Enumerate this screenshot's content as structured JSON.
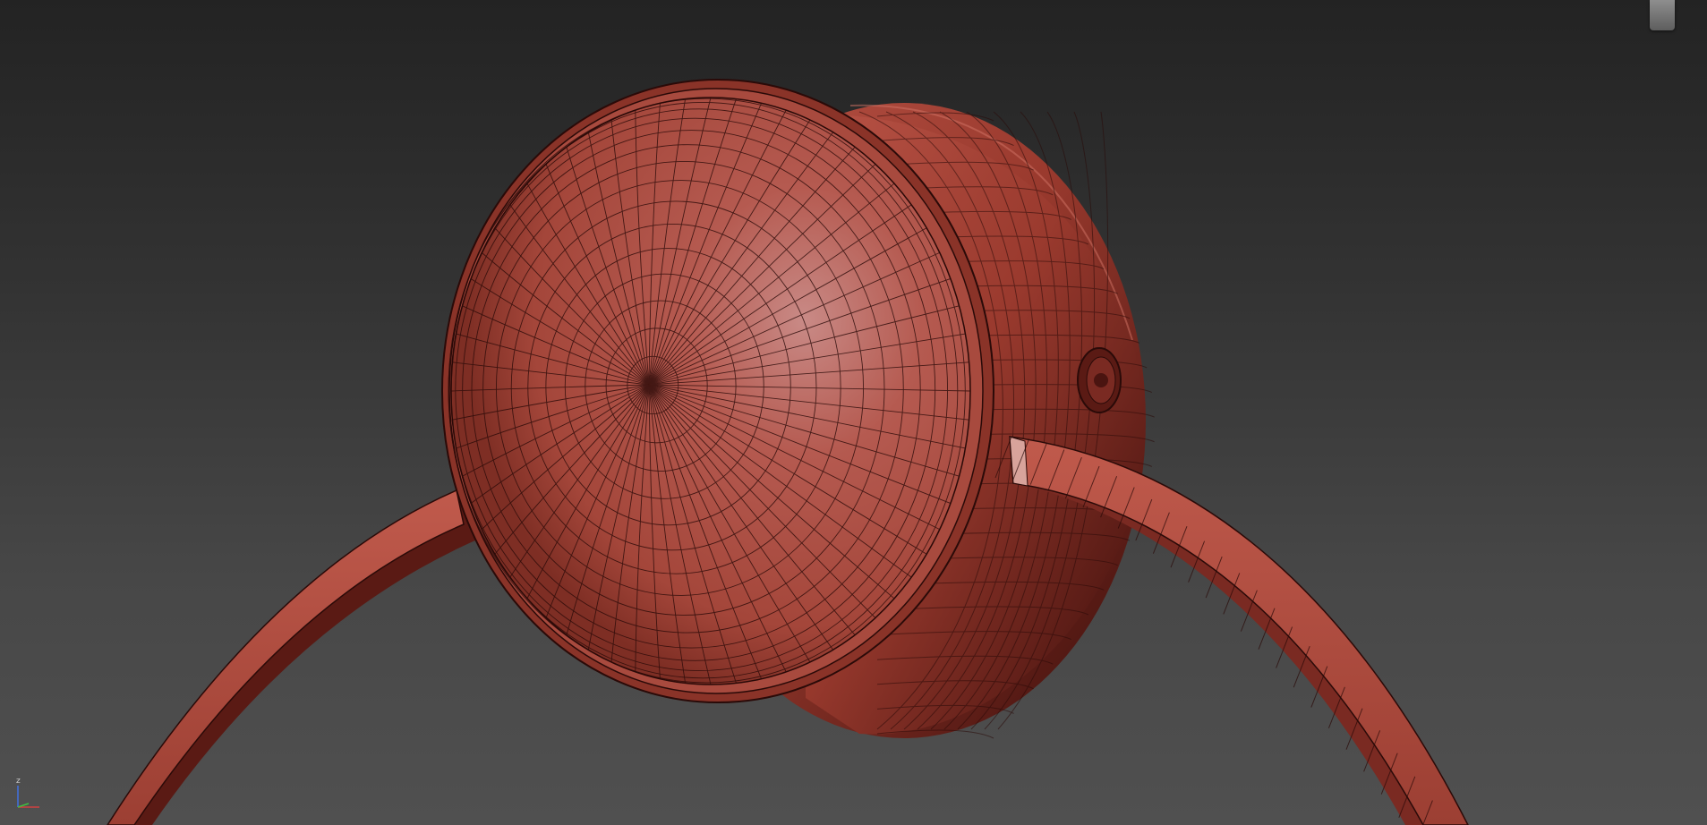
{
  "viewport": {
    "background_top": "#232323",
    "background_bottom": "#505050"
  },
  "model": {
    "name": "red-mesh-object",
    "base_color": "#b24c40",
    "highlight_color": "#c98a86",
    "shadow_color": "#3a0d0a",
    "wire_color": "#2a0a08"
  },
  "gizmo": {
    "axis_z_label": "z",
    "colors": {
      "x": "#d04040",
      "y": "#40c040",
      "z": "#4070e0"
    }
  },
  "icons": {
    "viewcube": "viewcube-icon",
    "axis": "axis-gizmo-icon"
  }
}
